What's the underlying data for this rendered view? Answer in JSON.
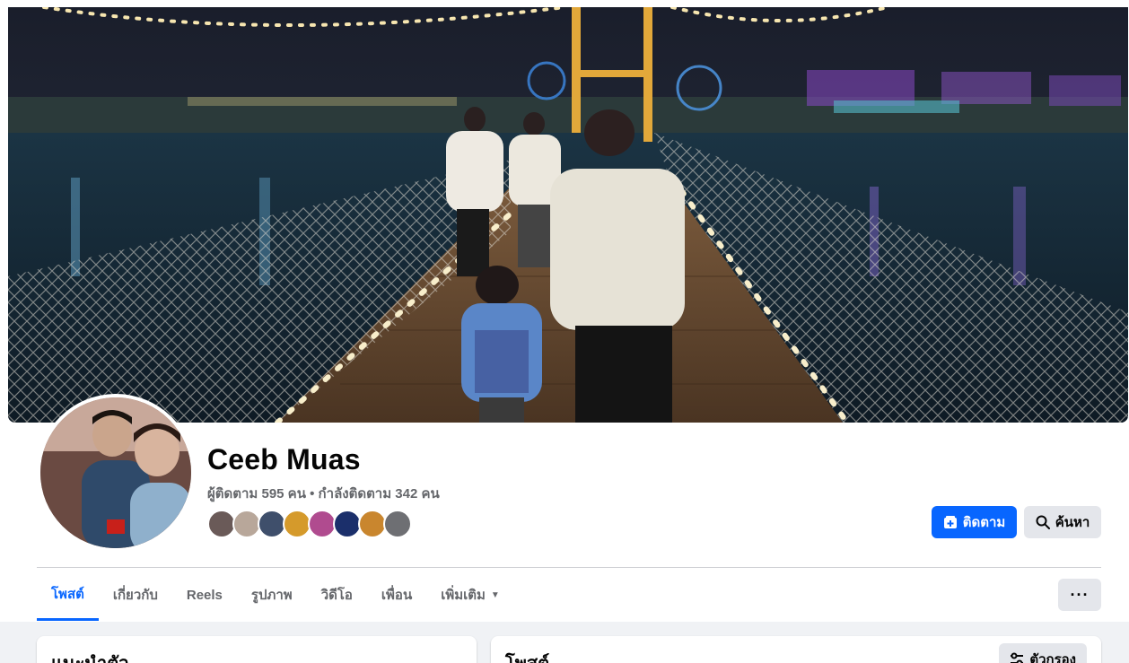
{
  "profile": {
    "name": "Ceeb Muas",
    "followers_text": "ผู้ติดตาม 595 คน • กำลังติดตาม 342 คน",
    "friend_avatar_colors": [
      "#6a5a58",
      "#b8a79a",
      "#3f4f6b",
      "#d59a2b",
      "#b04b8f",
      "#1b2f6b",
      "#c9862e",
      "#6e6f73"
    ]
  },
  "actions": {
    "follow_label": "ติดตาม",
    "search_label": "ค้นหา",
    "more_label": "···"
  },
  "tabs": [
    {
      "label": "โพสต์"
    },
    {
      "label": "เกี่ยวกับ"
    },
    {
      "label": "Reels"
    },
    {
      "label": "รูปภาพ"
    },
    {
      "label": "วิดีโอ"
    },
    {
      "label": "เพื่อน"
    },
    {
      "label": "เพิ่มเติม"
    }
  ],
  "cards": {
    "intro_title": "แนะนำตัว",
    "posts_title": "โพสต์",
    "filter_label": "ตัวกรอง"
  },
  "colors": {
    "accent": "#0866ff",
    "secondary_button": "#e4e6eb",
    "muted_text": "#65676b"
  }
}
